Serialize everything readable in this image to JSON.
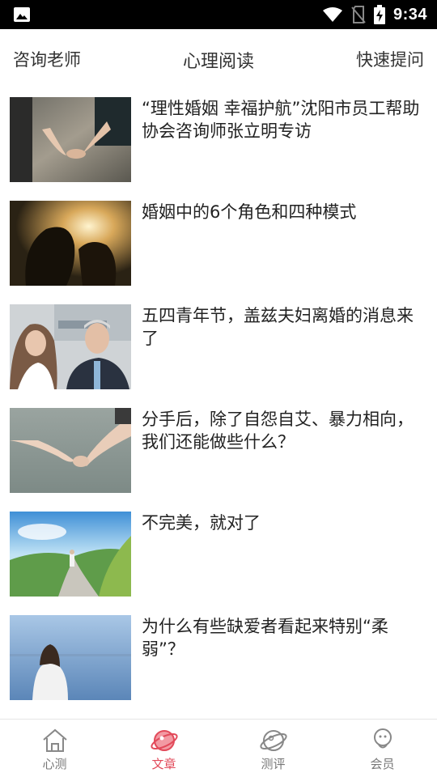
{
  "status_bar": {
    "time": "9:34"
  },
  "top_nav": {
    "left": "咨询老师",
    "title": "心理阅读",
    "right": "快速提问"
  },
  "articles": [
    {
      "title": "“理性婚姻 幸福护航”沈阳市员工帮助协会咨询师张立明专访"
    },
    {
      "title": "婚姻中的6个角色和四种模式"
    },
    {
      "title": "五四青年节，盖兹夫妇离婚的消息来了"
    },
    {
      "title": "分手后，除了自怨自艾、暴力相向，我们还能做些什么？"
    },
    {
      "title": "不完美，就对了"
    },
    {
      "title": "为什么有些缺爱者看起来特别“柔弱”？"
    }
  ],
  "tabs": [
    {
      "label": "心测",
      "icon": "house-icon",
      "active": false
    },
    {
      "label": "文章",
      "icon": "planet-icon",
      "active": true
    },
    {
      "label": "测评",
      "icon": "planet-outline-icon",
      "active": false
    },
    {
      "label": "会员",
      "icon": "person-icon",
      "active": false
    }
  ],
  "colors": {
    "accent": "#e24a5a",
    "tab_inactive": "#777777"
  }
}
